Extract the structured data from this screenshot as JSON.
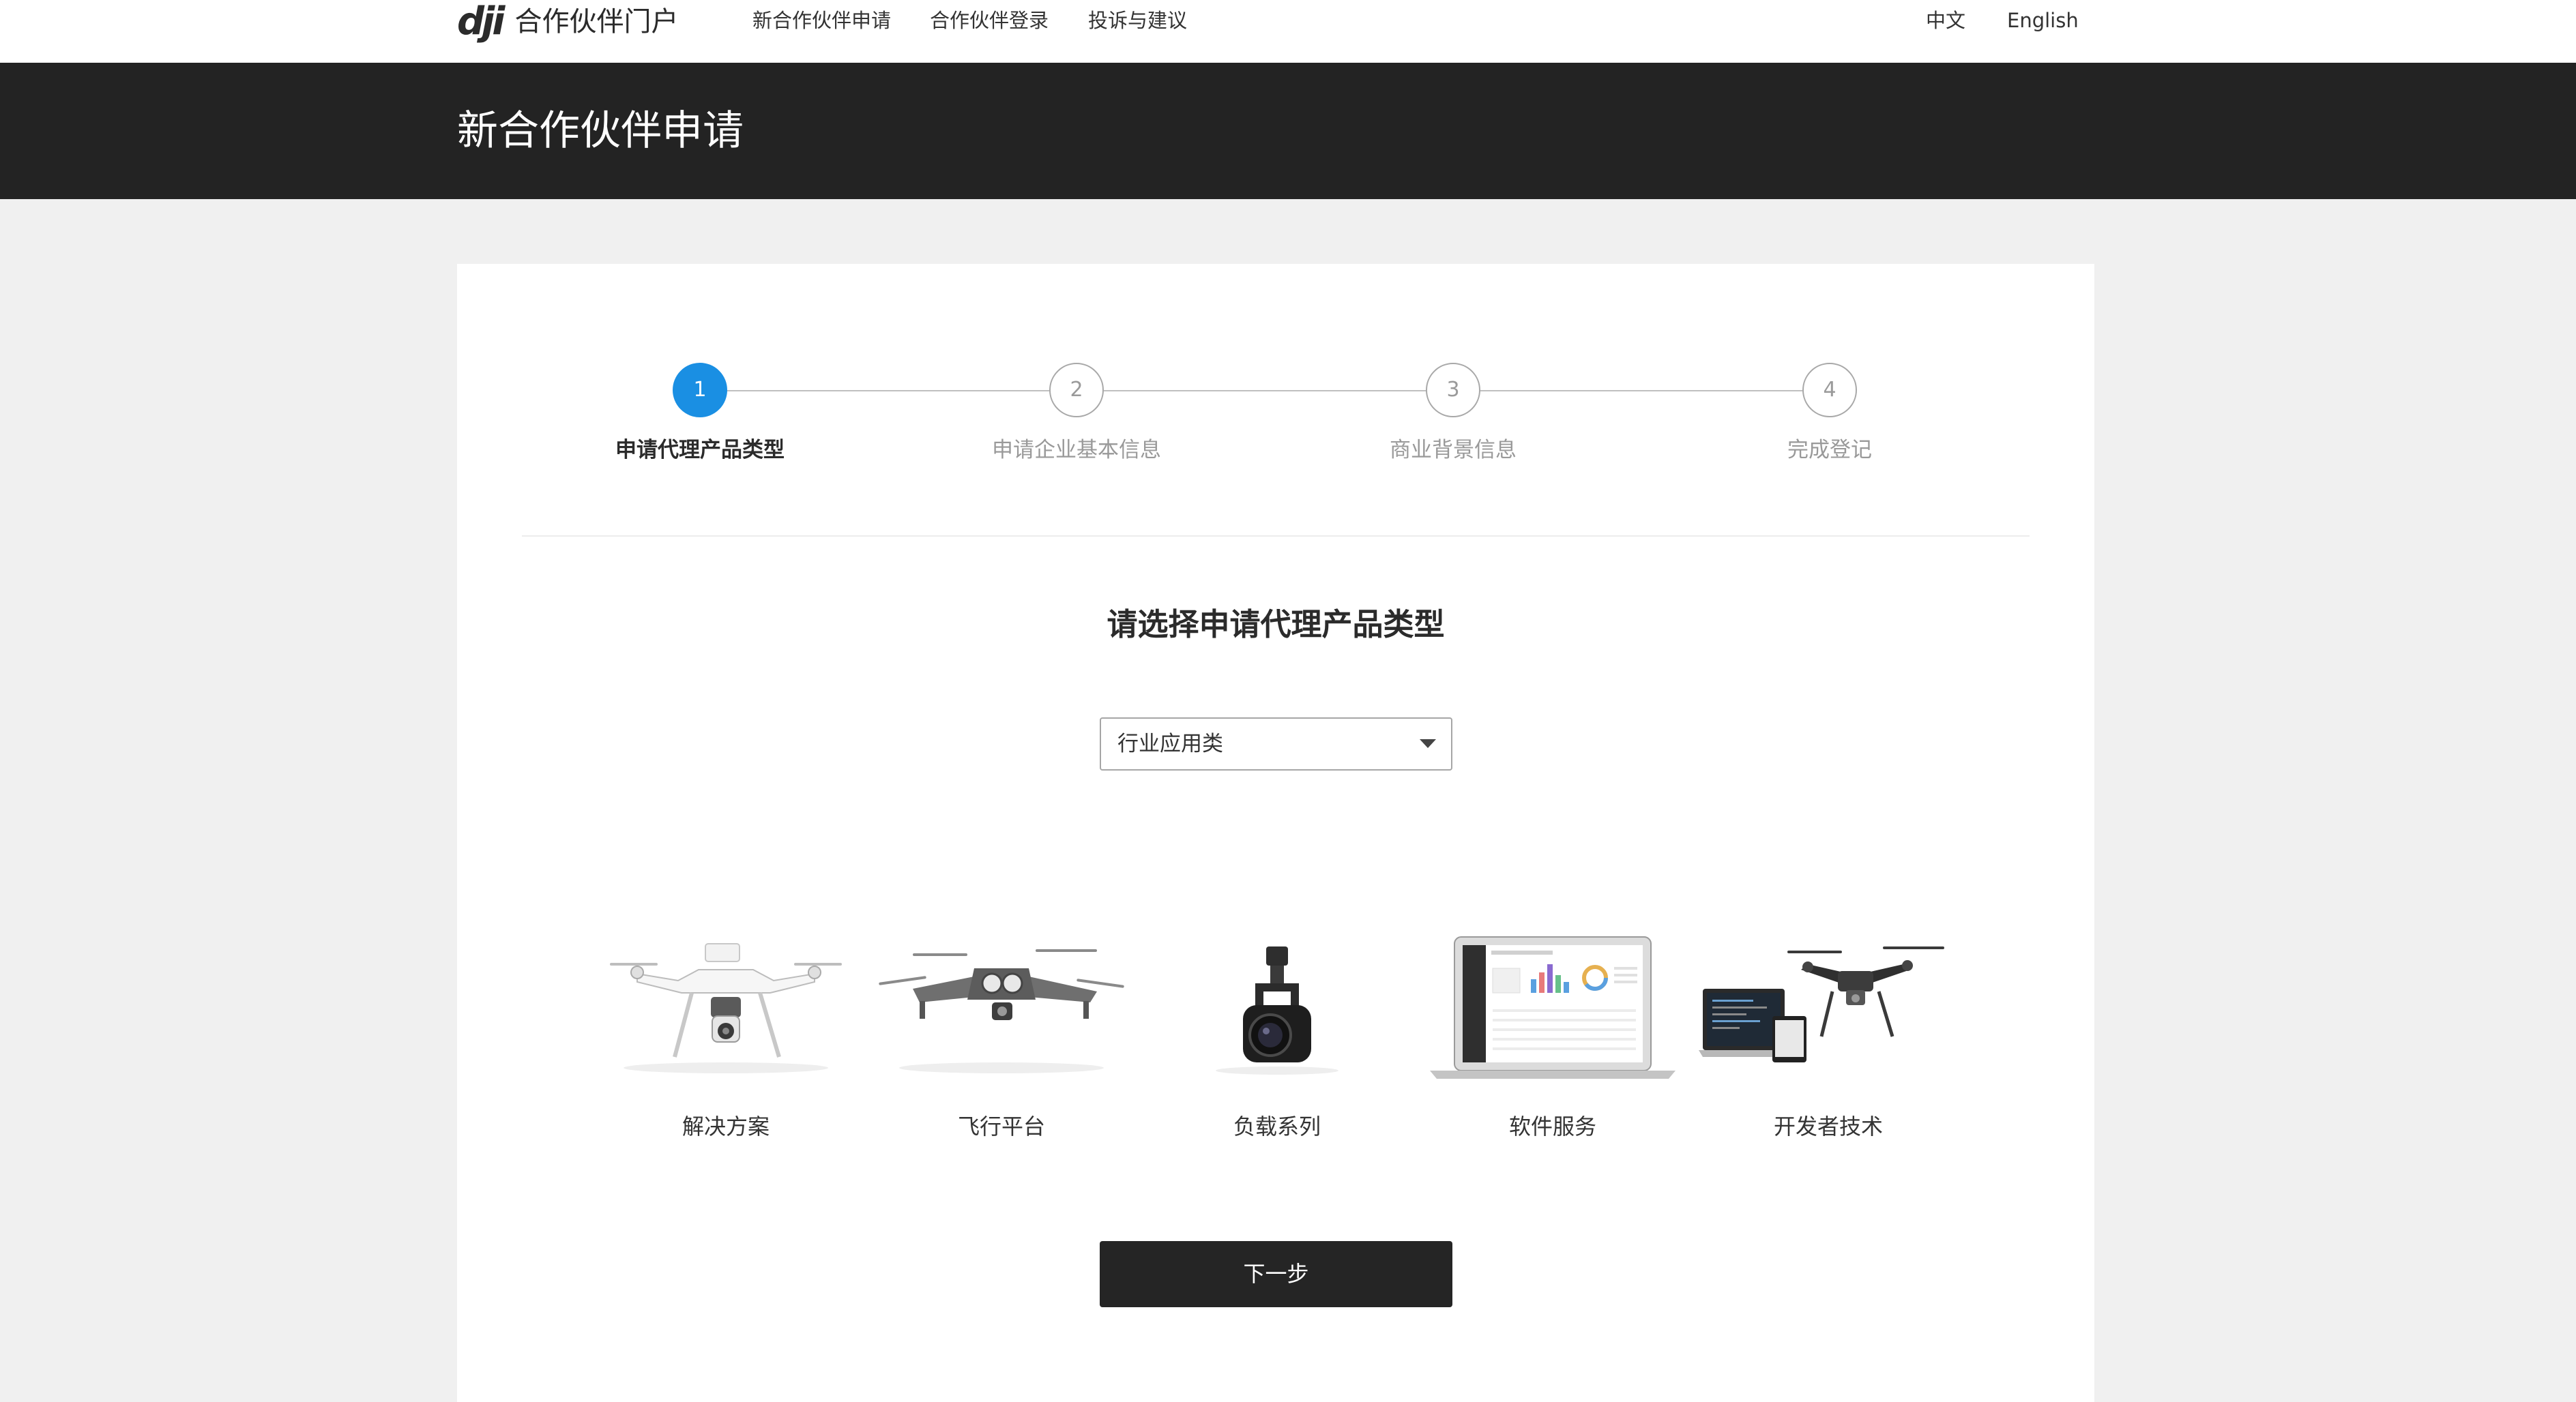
{
  "header": {
    "logo_mark": "dji",
    "logo_text": "合作伙伴门户",
    "nav": [
      "新合作伙伴申请",
      "合作伙伴登录",
      "投诉与建议"
    ],
    "lang": [
      "中文",
      "English"
    ]
  },
  "page": {
    "title": "新合作伙伴申请"
  },
  "stepper": {
    "current": 1,
    "steps": [
      {
        "number": "1",
        "label": "申请代理产品类型"
      },
      {
        "number": "2",
        "label": "申请企业基本信息"
      },
      {
        "number": "3",
        "label": "商业背景信息"
      },
      {
        "number": "4",
        "label": "完成登记"
      }
    ]
  },
  "form": {
    "heading": "请选择申请代理产品类型",
    "select_value": "行业应用类"
  },
  "products": [
    {
      "label": "解决方案",
      "icon": "drone-camera-icon"
    },
    {
      "label": "飞行平台",
      "icon": "foldable-drone-icon"
    },
    {
      "label": "负载系列",
      "icon": "gimbal-camera-icon"
    },
    {
      "label": "软件服务",
      "icon": "laptop-dashboard-icon"
    },
    {
      "label": "开发者技术",
      "icon": "drone-with-laptop-icon"
    }
  ],
  "actions": {
    "next_label": "下一步"
  },
  "colors": {
    "accent": "#1a8fe3",
    "header_band": "#232323",
    "button": "#252525",
    "page_bg": "#f0f0f0"
  }
}
